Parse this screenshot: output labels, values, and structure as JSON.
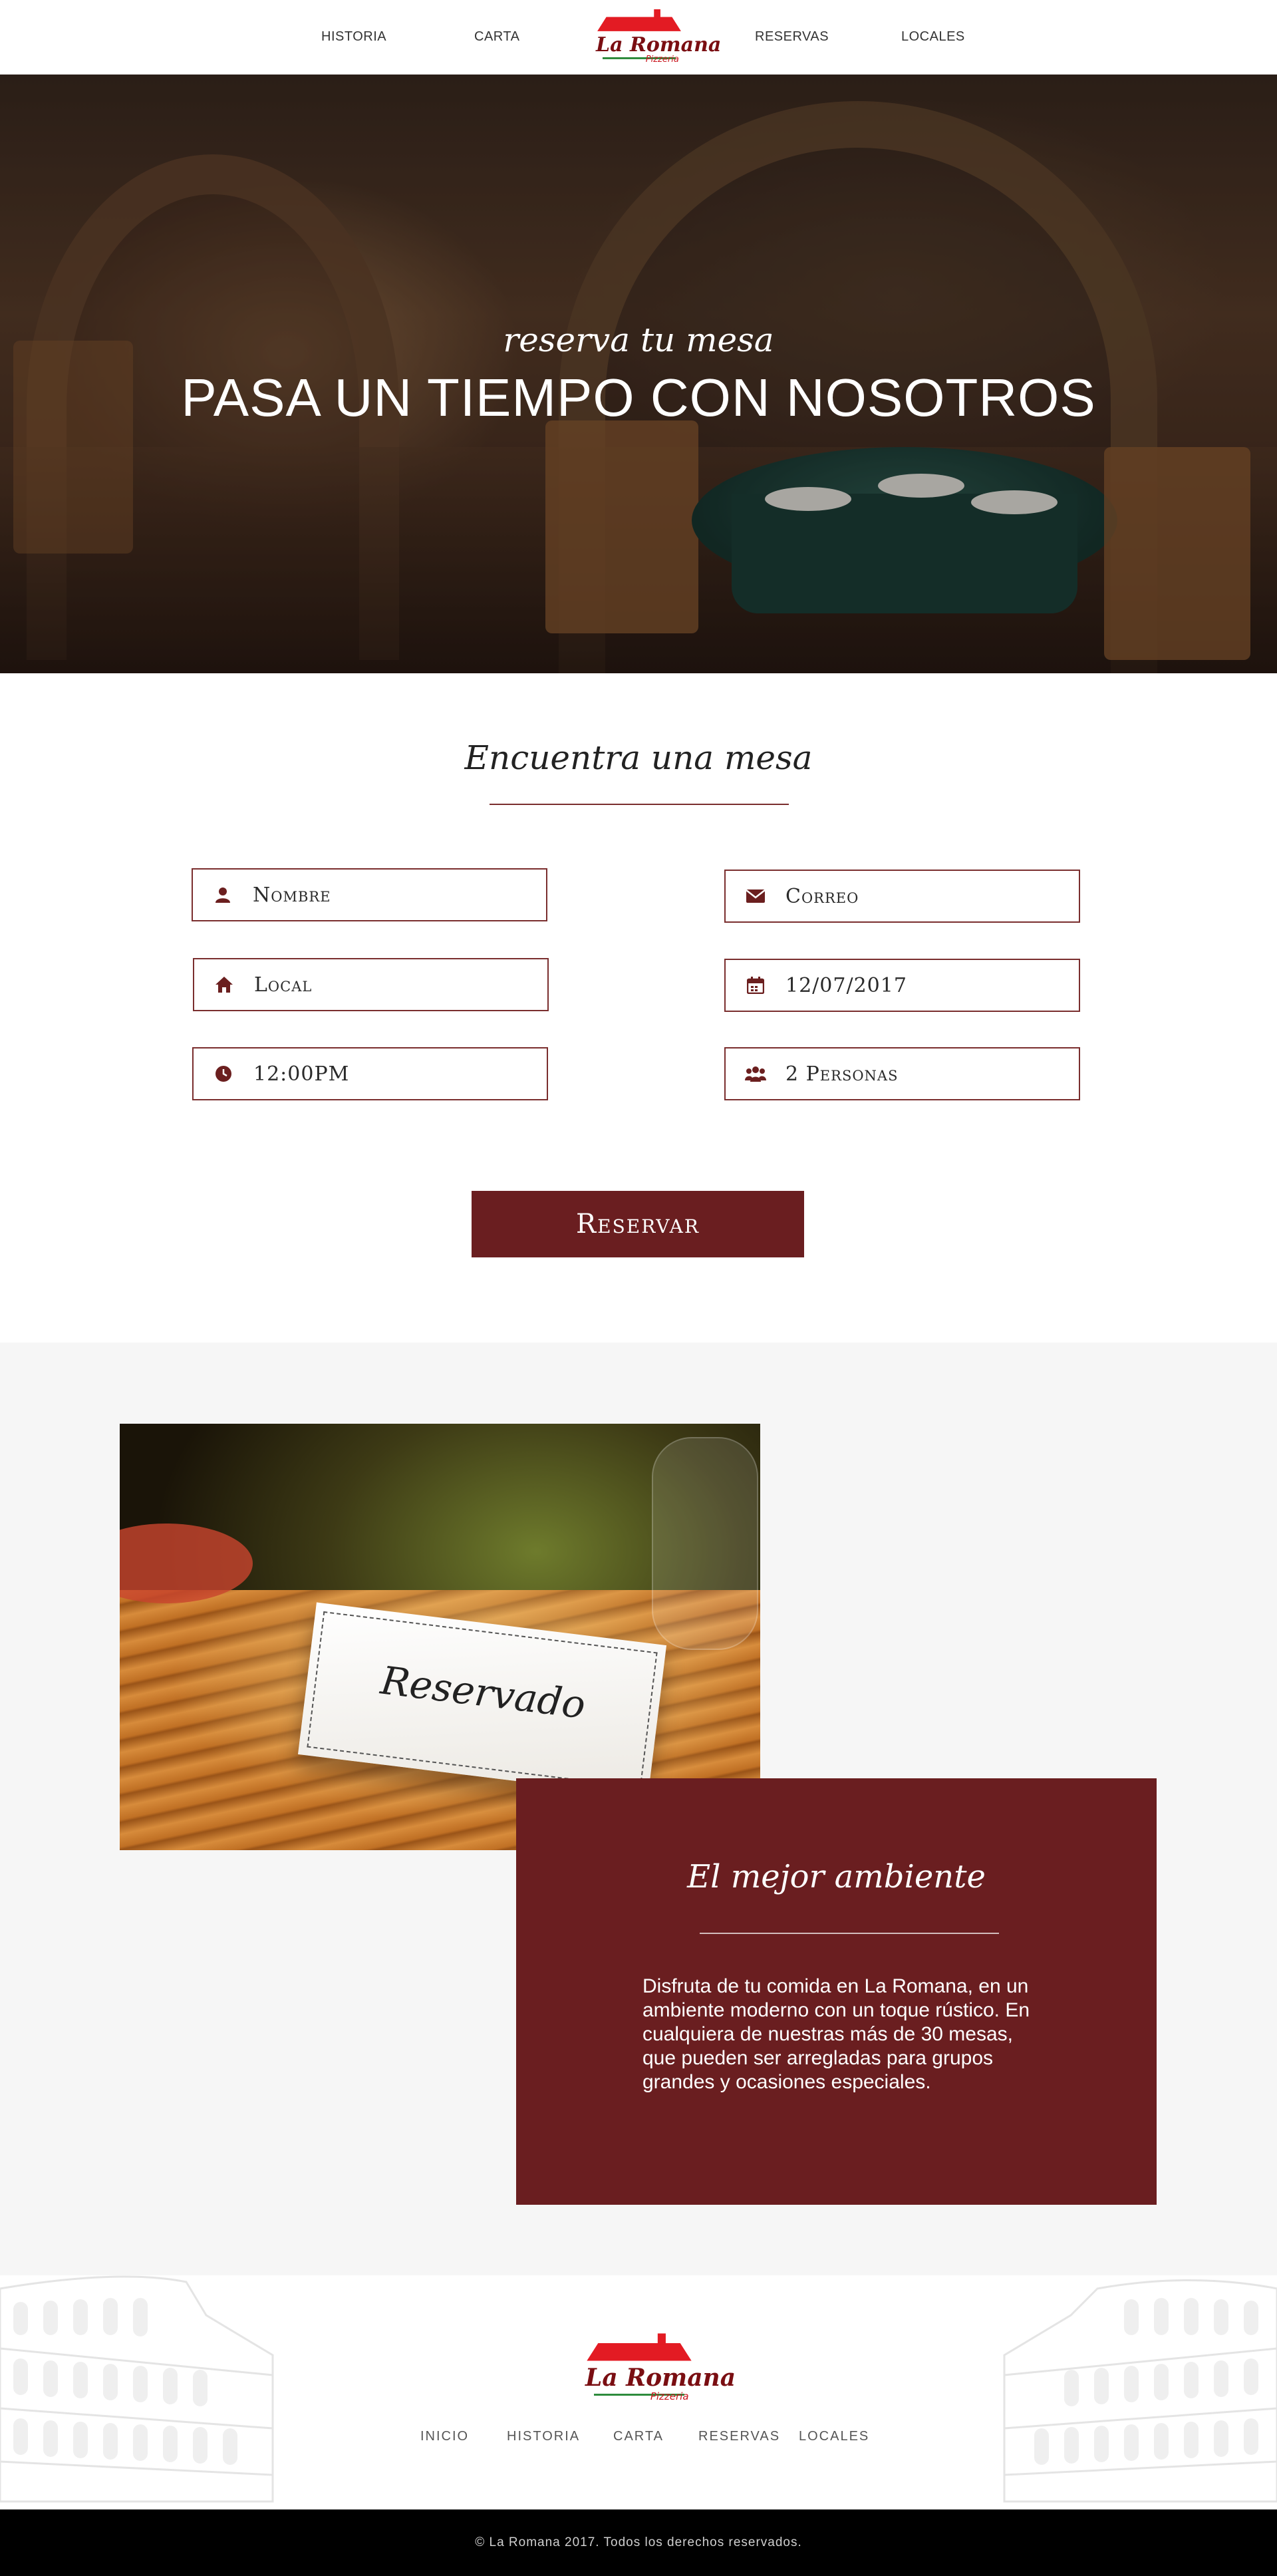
{
  "nav": {
    "items": [
      "HISTORIA",
      "CARTA",
      "RESERVAS",
      "LOCALES"
    ],
    "logo": {
      "brand": "La Romana",
      "sub": "Pizzeria"
    }
  },
  "hero": {
    "tagline": "reserva tu mesa",
    "headline": "PASA UN TIEMPO CON NOSOTROS"
  },
  "form": {
    "title": "Encuentra una mesa",
    "fields": [
      {
        "icon": "user-icon",
        "value": "Nombre"
      },
      {
        "icon": "envelope-icon",
        "value": "Correo"
      },
      {
        "icon": "home-icon",
        "value": "Local"
      },
      {
        "icon": "calendar-icon",
        "value": "12/07/2017"
      },
      {
        "icon": "clock-icon",
        "value": "12:00PM"
      },
      {
        "icon": "people-icon",
        "value": "2 Personas"
      }
    ],
    "button": "Reservar"
  },
  "ambiente": {
    "photo_text": "Reservado",
    "title": "El mejor ambiente",
    "text": "Disfruta de tu comida en La Romana, en un ambiente moderno con un toque rústico. En cualquiera de nuestras más de 30 mesas, que pueden ser arregladas para grupos grandes y ocasiones especiales."
  },
  "footer": {
    "logo": {
      "brand": "La Romana",
      "sub": "Pizzeria"
    },
    "links": [
      "INICIO",
      "HISTORIA",
      "CARTA",
      "RESERVAS",
      "LOCALES"
    ],
    "copyright": "© La Romana 2017. Todos los derechos reservados."
  },
  "colors": {
    "accent": "#6a1e20",
    "logo_red": "#e31b23",
    "logo_green": "#2e8b3d"
  }
}
